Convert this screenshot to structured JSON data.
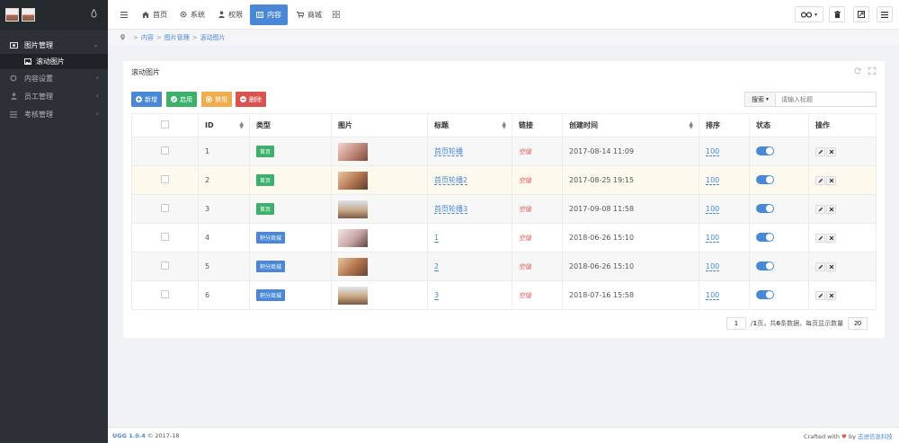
{
  "sidebar": {
    "menu": [
      {
        "label": "图片管理",
        "icon": "image-icon",
        "open": true
      },
      {
        "label": "内容设置",
        "icon": "settings-icon"
      },
      {
        "label": "员工管理",
        "icon": "user-icon"
      },
      {
        "label": "考核管理",
        "icon": "list-icon"
      }
    ],
    "sub_item": "滚动图片"
  },
  "topbar": {
    "items": [
      {
        "label": "首页",
        "icon": "home-icon"
      },
      {
        "label": "系统",
        "icon": "gear-icon"
      },
      {
        "label": "权限",
        "icon": "user-icon"
      },
      {
        "label": "内容",
        "icon": "grid-icon",
        "active": true
      },
      {
        "label": "商城",
        "icon": "cart-icon"
      }
    ]
  },
  "breadcrumb": [
    "内容",
    "图片管理",
    "滚动图片"
  ],
  "panel": {
    "title": "滚动图片",
    "buttons": [
      {
        "label": "新增",
        "color": "#4b87d7"
      },
      {
        "label": "启用",
        "color": "#3db16b"
      },
      {
        "label": "禁用",
        "color": "#f0ad4e"
      },
      {
        "label": "删除",
        "color": "#d9534f"
      }
    ],
    "search_label": "搜索",
    "search_placeholder": "请输入标题"
  },
  "table": {
    "headers": [
      "ID",
      "类型",
      "图片",
      "标题",
      "链接",
      "创建时间",
      "排序",
      "状态",
      "操作"
    ],
    "rows": [
      {
        "id": "1",
        "type": "首页",
        "type_color": "#3db16b",
        "title": "首页轮播",
        "link": "空值",
        "time": "2017-08-14 11:09",
        "sort": "100"
      },
      {
        "id": "2",
        "type": "首页",
        "type_color": "#3db16b",
        "title": "首页轮播2",
        "link": "空值",
        "time": "2017-08-25 19:15",
        "sort": "100"
      },
      {
        "id": "3",
        "type": "首页",
        "type_color": "#3db16b",
        "title": "首页轮播3",
        "link": "空值",
        "time": "2017-09-08 11:58",
        "sort": "100"
      },
      {
        "id": "4",
        "type": "积分商城",
        "type_color": "#4b87d7",
        "title": "1",
        "link": "空值",
        "time": "2018-06-26 15:10",
        "sort": "100"
      },
      {
        "id": "5",
        "type": "积分商城",
        "type_color": "#4b87d7",
        "title": "2",
        "link": "空值",
        "time": "2018-06-26 15:10",
        "sort": "100"
      },
      {
        "id": "6",
        "type": "积分商城",
        "type_color": "#4b87d7",
        "title": "3",
        "link": "空值",
        "time": "2018-07-16 15:58",
        "sort": "100"
      }
    ]
  },
  "pager": {
    "page": "1",
    "text_pre": "/ ",
    "total_pages": "1",
    "text_mid1": " 页，共 ",
    "total_records": "6",
    "text_mid2": " 条数据，每页显示数量",
    "page_size": "20"
  },
  "footer": {
    "version": "UGG 1.0.4",
    "copyright": "© 2017-18",
    "crafted": "Crafted with",
    "by": "by",
    "company": "志进信息科技"
  }
}
